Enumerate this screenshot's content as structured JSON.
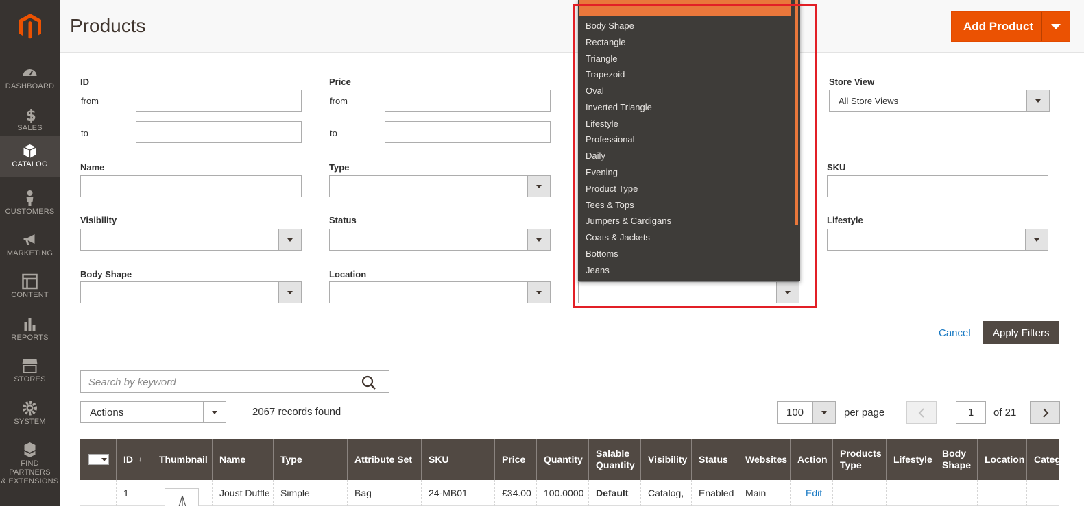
{
  "sidebar": {
    "items": [
      {
        "label": "DASHBOARD",
        "icon": "dashboard-icon"
      },
      {
        "label": "SALES",
        "icon": "dollar-icon"
      },
      {
        "label": "CATALOG",
        "icon": "cube-icon",
        "active": true
      },
      {
        "label": "CUSTOMERS",
        "icon": "person-icon"
      },
      {
        "label": "MARKETING",
        "icon": "megaphone-icon"
      },
      {
        "label": "CONTENT",
        "icon": "layout-icon"
      },
      {
        "label": "REPORTS",
        "icon": "bar-chart-icon"
      },
      {
        "label": "STORES",
        "icon": "store-icon"
      },
      {
        "label": "SYSTEM",
        "icon": "gear-icon"
      },
      {
        "label": "FIND PARTNERS\n& EXTENSIONS",
        "icon": "boxes-icon"
      }
    ]
  },
  "header": {
    "title": "Products",
    "add_button": "Add Product"
  },
  "filters": {
    "id_label": "ID",
    "price_label": "Price",
    "from": "from",
    "to": "to",
    "store_view_label": "Store View",
    "store_view_value": "All Store Views",
    "name_label": "Name",
    "type_label": "Type",
    "sku_label": "SKU",
    "visibility_label": "Visibility",
    "status_label": "Status",
    "lifestyle_label": "Lifestyle",
    "body_shape_label": "Body Shape",
    "location_label": "Location",
    "cancel": "Cancel",
    "apply": "Apply Filters"
  },
  "dropdown": {
    "options": [
      "Body Shape",
      "Rectangle",
      "Triangle",
      "Trapezoid",
      "Oval",
      "Inverted Triangle",
      "Lifestyle",
      "Professional",
      "Daily",
      "Evening",
      "Product Type",
      "Tees & Tops",
      "Jumpers & Cardigans",
      "Coats & Jackets",
      "Bottoms",
      "Jeans"
    ]
  },
  "toolbar": {
    "search_placeholder": "Search by keyword",
    "actions": "Actions",
    "records": "2067 records found",
    "per_page_value": "100",
    "per_page_label": "per page",
    "page": "1",
    "of_pages": "of 21"
  },
  "grid": {
    "columns": [
      "ID",
      "Thumbnail",
      "Name",
      "Type",
      "Attribute Set",
      "SKU",
      "Price",
      "Quantity",
      "Salable Quantity",
      "Visibility",
      "Status",
      "Websites",
      "Action",
      "Products Type",
      "Lifestyle",
      "Body Shape",
      "Location",
      "Categ"
    ],
    "row": {
      "id": "1",
      "name": "Joust Duffle",
      "type": "Simple",
      "attribute_set": "Bag",
      "sku": "24-MB01",
      "price": "£34.00",
      "quantity": "100.0000",
      "salable": "Default",
      "visibility": "Catalog,",
      "status": "Enabled",
      "websites": "Main",
      "action": "Edit"
    }
  },
  "colors": {
    "accent": "#eb5202",
    "sidebar": "#373330",
    "grid_header": "#514943",
    "highlight": "#e21f26"
  }
}
